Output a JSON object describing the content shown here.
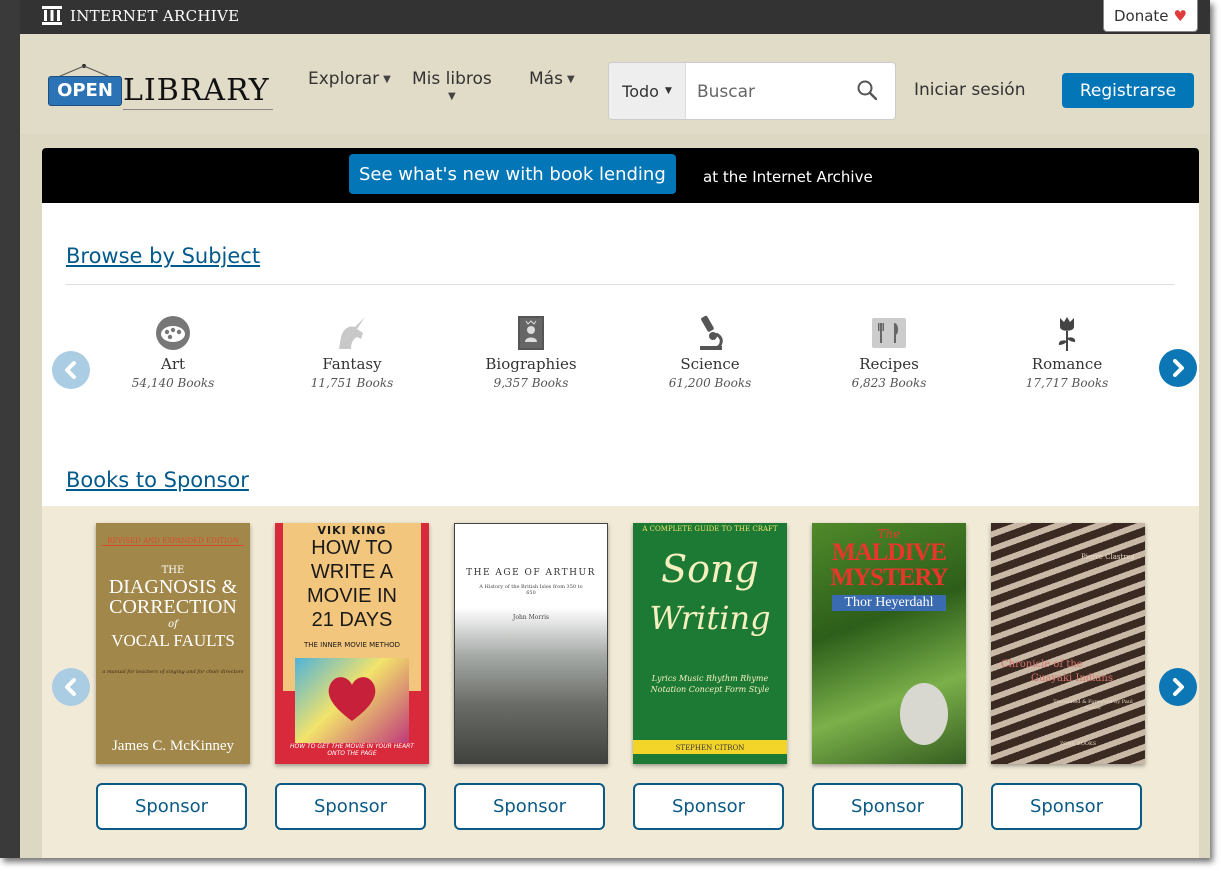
{
  "ia_bar": {
    "logo_text": "INTERNET ARCHIVE",
    "donate_label": "Donate",
    "donate_heart": "♥"
  },
  "header": {
    "logo": {
      "open": "OPEN",
      "library": "LIBRARY"
    },
    "nav": {
      "explorar": "Explorar",
      "mis_libros": "Mis libros",
      "mas": "Más"
    },
    "search": {
      "scope": "Todo",
      "placeholder": "Buscar"
    },
    "login": "Iniciar sesión",
    "register": "Registrarse"
  },
  "banner": {
    "link": "See what's new with book lending",
    "text": "at the Internet Archive"
  },
  "browse": {
    "title": "Browse by Subject",
    "subjects": [
      {
        "name": "Art",
        "count": "54,140 Books",
        "icon": "palette-icon"
      },
      {
        "name": "Fantasy",
        "count": "11,751 Books",
        "icon": "unicorn-icon"
      },
      {
        "name": "Biographies",
        "count": "9,357 Books",
        "icon": "biography-book-icon"
      },
      {
        "name": "Science",
        "count": "61,200 Books",
        "icon": "microscope-icon"
      },
      {
        "name": "Recipes",
        "count": "6,823 Books",
        "icon": "cutlery-icon"
      },
      {
        "name": "Romance",
        "count": "17,717 Books",
        "icon": "rose-icon"
      }
    ]
  },
  "sponsor": {
    "title": "Books to Sponsor",
    "button_label": "Sponsor",
    "books": [
      {
        "top": "REVISED AND EXPANDED EDITION",
        "title1": "THE",
        "title2": "DIAGNOSIS & CORRECTION",
        "title3": "of",
        "title4": "VOCAL FAULTS",
        "sub": "a manual for teachers of singing and for choir directors",
        "author": "James C. McKinney"
      },
      {
        "top": "VIKI KING",
        "title1": "HOW TO",
        "title2": "WRITE A",
        "title3": "MOVIE IN",
        "title4": "21 DAYS",
        "sub": "THE INNER MOVIE METHOD",
        "author": "HOW TO GET THE MOVIE IN YOUR HEART ONTO THE PAGE"
      },
      {
        "title1": "THE AGE OF ARTHUR",
        "sub": "A History of the British Isles from 350 to 650",
        "author": "John Morris"
      },
      {
        "top": "A COMPLETE GUIDE TO THE CRAFT",
        "title1": "Song",
        "title2": "Writing",
        "sub": "Lyrics  Music  Rhythm Rhyme  Notation Concept  Form  Style",
        "author": "STEPHEN CITRON"
      },
      {
        "title1": "The",
        "title2": "MALDIVE",
        "title3": "MYSTERY",
        "author": "Thor Heyerdahl"
      },
      {
        "top": "Pierre Clastres",
        "title1": "Chronicle of the",
        "title2": "Guayaki Indians",
        "sub": "Translated & Foreword by Paul Auster",
        "author": "ZONE BOOKS"
      }
    ]
  },
  "colors": {
    "link": "#02598b",
    "accent": "#0376b8",
    "page_bg": "#dcd8c2",
    "sponsor_band": "#f1ead7"
  }
}
